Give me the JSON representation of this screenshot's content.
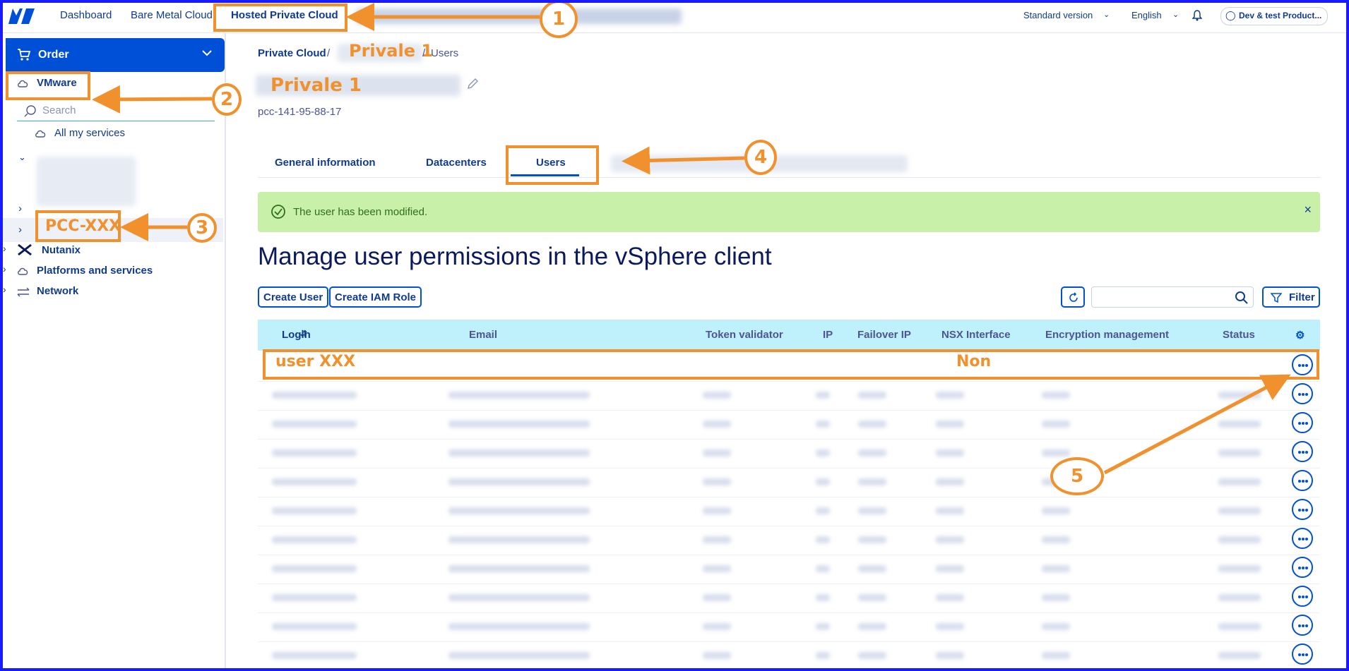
{
  "topbar": {
    "nav": [
      "Dashboard",
      "Bare Metal Cloud",
      "Hosted Private Cloud"
    ],
    "version": "Standard version",
    "language": "English",
    "account": "Dev & test Product..."
  },
  "sidebar": {
    "order_label": "Order",
    "vmware": "VMware",
    "search_placeholder": "Search",
    "all_services": "All my services",
    "pcc": "PCC-XXX",
    "nutanix": "Nutanix",
    "platforms": "Platforms and services",
    "network": "Network"
  },
  "breadcrumb": {
    "root": "Private Cloud",
    "sep": "/",
    "name": "Privale 1",
    "sep2": "/",
    "current": "Users"
  },
  "header": {
    "title": "Privale 1",
    "service_id": "pcc-141-95-88-17"
  },
  "tabs": [
    "General information",
    "Datacenters",
    "Users"
  ],
  "alert": {
    "message": "The user has been modified.",
    "close": "×"
  },
  "page_title": "Manage user permissions in the vSphere client",
  "toolbar": {
    "create_user": "Create User",
    "create_iam": "Create IAM Role",
    "filter": "Filter"
  },
  "table": {
    "headers": [
      "Login",
      "Email",
      "Token validator",
      "IP",
      "Failover IP",
      "NSX Interface",
      "Encryption management",
      "Status"
    ],
    "first_row": {
      "login": "user XXX",
      "nsx": "Non"
    },
    "row_count": 11
  },
  "annotations": [
    "1",
    "2",
    "3",
    "4",
    "5"
  ],
  "colors": {
    "accent": "#0050d7",
    "annotation": "#f0912e",
    "header_bg": "#bef1fc",
    "alert_bg": "#c8f0a8"
  }
}
